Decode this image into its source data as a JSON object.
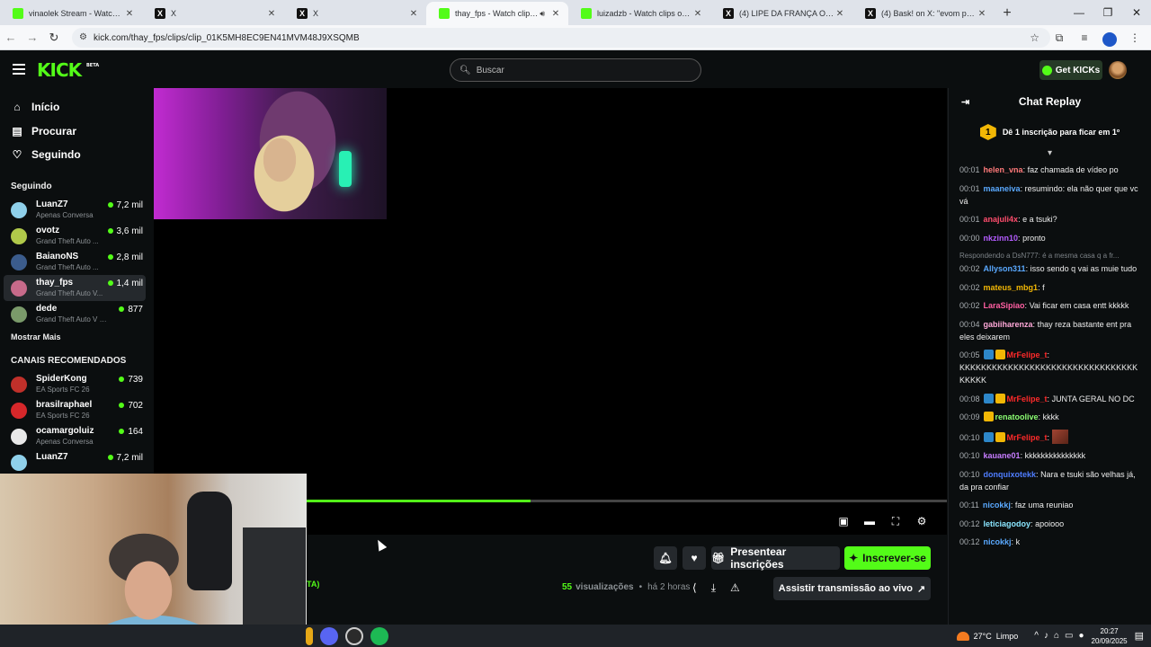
{
  "browser": {
    "tabs": [
      {
        "title": "vinaolek Stream - Watch Live o",
        "favicon": "kick",
        "active": false
      },
      {
        "title": "X",
        "favicon": "x",
        "active": false
      },
      {
        "title": "X",
        "favicon": "x",
        "active": false
      },
      {
        "title": "thay_fps - Watch clips on Ki",
        "favicon": "kick",
        "active": true,
        "audio": true
      },
      {
        "title": "luizadzb - Watch clips on Kick",
        "favicon": "kick",
        "active": false
      },
      {
        "title": "(4) LIPE DA FRANÇA OFC on",
        "favicon": "x",
        "active": false
      },
      {
        "title": "(4) Bask! on X: \"evom pra krl ht",
        "favicon": "x",
        "active": false
      }
    ],
    "new_tab": "+",
    "url": "kick.com/thay_fps/clips/clip_01K5MH8EC9EN41MVM48J9XSQMB"
  },
  "topnav": {
    "search_placeholder": "Buscar",
    "get_kicks": "Get KICKs",
    "logo": "KICK",
    "logo_tag": "BETA"
  },
  "sidebar": {
    "nav": [
      {
        "label": "Início",
        "icon": "home-icon"
      },
      {
        "label": "Procurar",
        "icon": "browse-icon"
      },
      {
        "label": "Seguindo",
        "icon": "heart-icon"
      }
    ],
    "following_title": "Seguindo",
    "following": [
      {
        "name": "LuanZ7",
        "game": "Apenas Conversa",
        "viewers": "7,2 mil",
        "color": "#8fd0ea"
      },
      {
        "name": "ovotz",
        "game": "Grand Theft Auto ...",
        "viewers": "3,6 mil",
        "color": "#b0c94a"
      },
      {
        "name": "BaianoNS",
        "game": "Grand Theft Auto ...",
        "viewers": "2,8 mil",
        "color": "#3b5c8c"
      },
      {
        "name": "thay_fps",
        "game": "Grand Theft Auto V...",
        "viewers": "1,4 mil",
        "color": "#c76a8a",
        "active": true
      },
      {
        "name": "dede",
        "game": "Grand Theft Auto V (G...",
        "viewers": "877",
        "color": "#7a9a6a"
      }
    ],
    "show_more": "Mostrar Mais",
    "recommended_title": "CANAIS RECOMENDADOS",
    "recommended": [
      {
        "name": "SpiderKong",
        "game": "EA Sports FC 26",
        "viewers": "739",
        "color": "#c0302a"
      },
      {
        "name": "brasilraphael",
        "game": "EA Sports FC 26",
        "viewers": "702",
        "color": "#d6272a"
      },
      {
        "name": "ocamargoluiz",
        "game": "Apenas Conversa",
        "viewers": "164",
        "color": "#e8e8e8"
      },
      {
        "name": "LuanZ7",
        "game": "",
        "viewers": "7,2 mil",
        "color": "#8fd0ea"
      }
    ]
  },
  "player": {
    "progress": 0.475
  },
  "below": {
    "gift_subs": "Presentear inscrições",
    "subscribe": "Inscrever-se",
    "views": "55",
    "views_label": "visualizações",
    "separator": "•",
    "time_ago": "há 2 horas",
    "watch_live": "Assistir transmissão ao vivo",
    "tag_text": "TA)"
  },
  "chat": {
    "title": "Chat Replay",
    "pinned_number": "1",
    "pinned_text": "Dê 1 inscrição para ficar em 1º",
    "messages": [
      {
        "time": "00:01",
        "user": "helen_vna",
        "color": "#ff7a7a",
        "text": "faz chamada de vídeo po"
      },
      {
        "time": "00:01",
        "user": "maaneiva",
        "color": "#5aa9ff",
        "text": "resumindo: ela não quer que vc vá"
      },
      {
        "time": "00:01",
        "user": "anajuli4x",
        "color": "#ff4d6d",
        "text": "e a tsuki?"
      },
      {
        "time": "00:00",
        "user": "nkzinn10",
        "color": "#b45cff",
        "text": "pronto"
      },
      {
        "time": "00:02",
        "user": "Allyson311",
        "color": "#5aa9ff",
        "text": "isso sendo q vai as muie tudo",
        "reply": "Respondendo a DsN777: é a mesma casa q a fr..."
      },
      {
        "time": "00:02",
        "user": "mateus_mbg1",
        "color": "#f2b705",
        "text": "f"
      },
      {
        "time": "00:02",
        "user": "LaraSipiao",
        "color": "#ff5fa2",
        "text": "Vai ficar em casa entt kkkkk"
      },
      {
        "time": "00:04",
        "user": "gabiiharenza",
        "color": "#ffa8d8",
        "text": "thay reza bastante ent pra eles deixarem"
      },
      {
        "time": "00:05",
        "user": "MrFelipe_t",
        "color": "#ff2a2a",
        "badges": 2,
        "text": "KKKKKKKKKKKKKKKKKKKKKKKKKKKKKKKKKKKKKK"
      },
      {
        "time": "00:08",
        "user": "MrFelipe_t",
        "color": "#ff2a2a",
        "badges": 2,
        "text": "JUNTA GERAL NO DC"
      },
      {
        "time": "00:09",
        "user": "renatoolive",
        "color": "#8cff73",
        "badges": 1,
        "text": "kkkk"
      },
      {
        "time": "00:10",
        "user": "MrFelipe_t",
        "color": "#ff2a2a",
        "badges": 2,
        "text": "",
        "emote": true
      },
      {
        "time": "00:10",
        "user": "kauane01",
        "color": "#c77dff",
        "text": "kkkkkkkkkkkkkkk"
      },
      {
        "time": "00:10",
        "user": "donquixotekk",
        "color": "#4f7dff",
        "text": "Nara e tsuki são velhas já, da pra confiar"
      },
      {
        "time": "00:11",
        "user": "nicokkj",
        "color": "#5aa9ff",
        "text": "faz uma reuniao"
      },
      {
        "time": "00:12",
        "user": "leticiagodoy",
        "color": "#8ae6ff",
        "text": "apoiooo"
      },
      {
        "time": "00:12",
        "user": "nicokkj",
        "color": "#5aa9ff",
        "text": "k"
      }
    ]
  },
  "taskbar": {
    "temperature": "27°C",
    "weather": "Limpo",
    "time": "20:27",
    "date": "20/09/2025"
  }
}
